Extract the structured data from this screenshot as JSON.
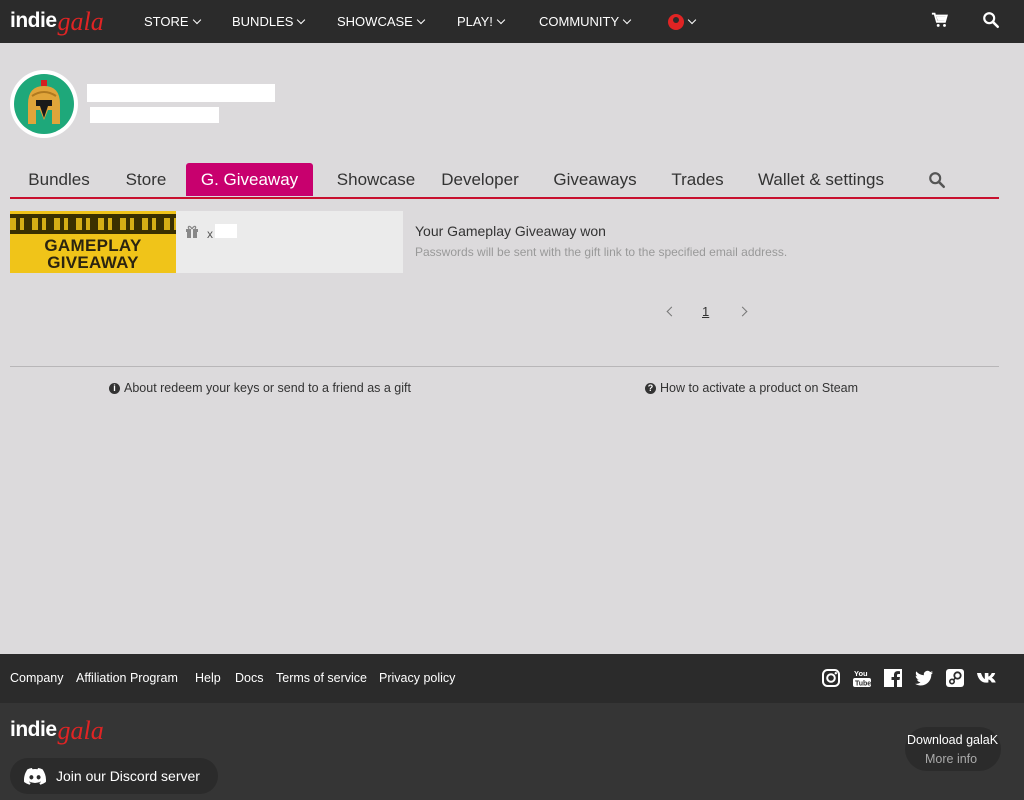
{
  "header": {
    "logo_a": "indie",
    "logo_b": "gala",
    "nav": [
      "STORE",
      "BUNDLES",
      "SHOWCASE",
      "PLAY!",
      "COMMUNITY"
    ]
  },
  "profile_tabs": [
    "Bundles",
    "Store",
    "G. Giveaway",
    "Showcase",
    "Developer",
    "Giveaways",
    "Trades",
    "Wallet & settings"
  ],
  "active_tab": "G. Giveaway",
  "giveaway_card": {
    "banner_line1": "GAMEPLAY",
    "banner_line2": "GIVEAWAY",
    "qty_prefix": "x"
  },
  "won": {
    "title": "Your Gameplay Giveaway won",
    "subtitle": "Passwords will be sent with the gift link to the specified email address."
  },
  "pagination": {
    "current": "1"
  },
  "help_links": {
    "redeem": "About redeem your keys or send to a friend as a gift",
    "steam": "How to activate a product on Steam"
  },
  "footer": {
    "links": [
      "Company",
      "Affiliation Program",
      "Help",
      "Docs",
      "Terms of service",
      "Privacy policy"
    ],
    "social_icons": [
      "instagram-icon",
      "youtube-icon",
      "facebook-icon",
      "twitter-icon",
      "steam-icon",
      "vk-icon"
    ],
    "discord_label": "Join our Discord server",
    "galak_line1": "Download galaK",
    "galak_line2": "More info"
  },
  "colors": {
    "accent_red": "#c8102e",
    "active_tab_bg": "#c8006e",
    "topbar_bg": "#2b2b2b",
    "page_bg": "#dcdadc"
  }
}
